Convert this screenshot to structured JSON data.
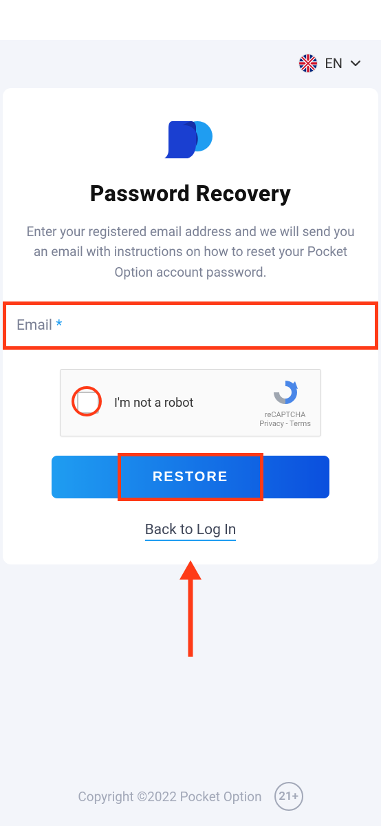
{
  "header": {
    "language_code": "EN"
  },
  "card": {
    "title": "Password Recovery",
    "description": "Enter your registered email address and we will send you an email with instructions on how to reset your Pocket Option account password.",
    "email_label": "Email",
    "email_required_mark": "*",
    "restore_button": "RESTORE",
    "back_link": "Back to Log In"
  },
  "captcha": {
    "label": "I'm not a robot",
    "brand": "reCAPTCHA",
    "privacy": "Privacy",
    "terms": "Terms"
  },
  "footer": {
    "copyright": "Copyright ©2022 Pocket Option",
    "age_badge": "21+"
  }
}
